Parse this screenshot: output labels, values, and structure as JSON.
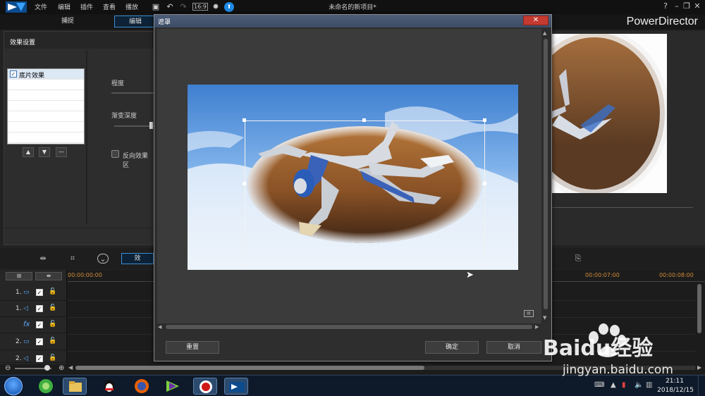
{
  "menu": {
    "items": [
      "文件",
      "编辑",
      "插件",
      "查看",
      "播放"
    ],
    "project_title": "未命名的新项目*",
    "help": "?"
  },
  "mode_tabs": {
    "capture": "捕捉",
    "edit": "编辑"
  },
  "brand": "PowerDirector",
  "effect_panel": {
    "title": "效果设置",
    "list_item": "底片效果",
    "degree_label": "程度",
    "gradient_label": "渐变深度",
    "invert_label": "反向效果区"
  },
  "lower_toolbar": {
    "effect_tab": "效"
  },
  "timeline": {
    "tracks": [
      {
        "num": "1."
      },
      {
        "num": "1."
      },
      {
        "num": "fx"
      },
      {
        "num": "2."
      },
      {
        "num": "2."
      }
    ],
    "times": [
      "00:00:00:00",
      "00:00:07:00",
      "00:00:08:00"
    ]
  },
  "dialog": {
    "title": "遮罩",
    "reset": "重置",
    "ok": "确定",
    "cancel": "取消"
  },
  "taskbar": {
    "time": "21:11",
    "date": "2018/12/15"
  },
  "watermark": {
    "brand": "Baidu经验",
    "url": "jingyan.baidu.com"
  },
  "colors": {
    "accent": "#1e88e5",
    "timecode": "#d08a3a",
    "close_button": "#c43a30"
  }
}
